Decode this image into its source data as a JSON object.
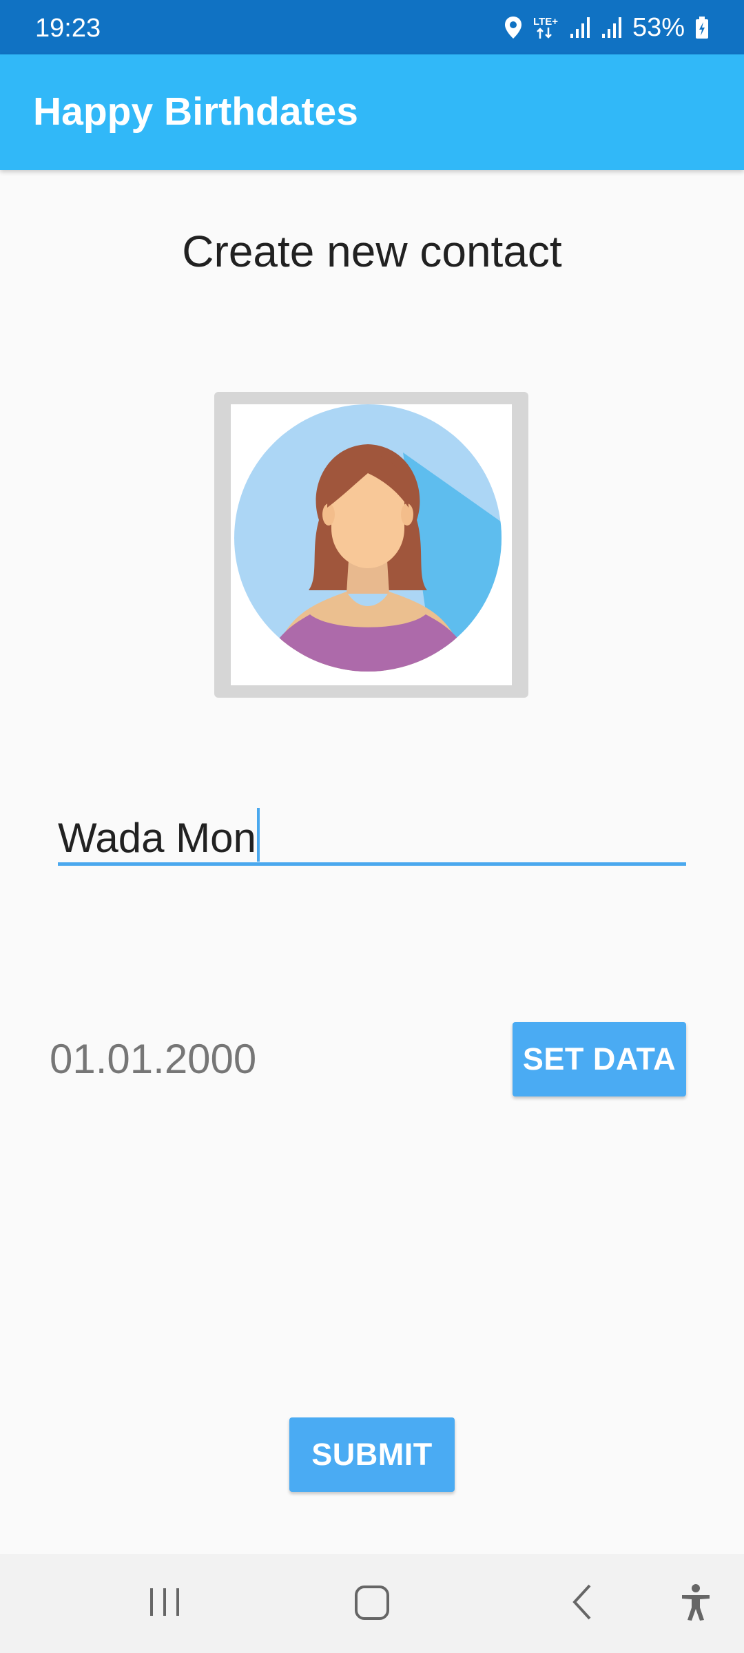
{
  "status_bar": {
    "time": "19:23",
    "network_type": "LTE+",
    "battery": "53%",
    "icons": [
      "location-icon",
      "lte-data-icon",
      "signal-icon",
      "signal-icon",
      "battery-charging-icon"
    ]
  },
  "app_bar": {
    "title": "Happy Birthdates"
  },
  "page": {
    "heading": "Create new contact"
  },
  "avatar": {
    "icon": "female-avatar-icon"
  },
  "name_field": {
    "value": "Wada Mon"
  },
  "date": {
    "value": "01.01.2000",
    "button_label": "SET DATA"
  },
  "submit": {
    "label": "SUBMIT"
  },
  "nav_bar": {
    "items": [
      "recent-apps-icon",
      "home-icon",
      "back-icon",
      "accessibility-icon"
    ]
  },
  "colors": {
    "status_bar": "#1072c3",
    "app_bar": "#31b8f8",
    "accent": "#4aabf3",
    "background": "#fafafa"
  }
}
